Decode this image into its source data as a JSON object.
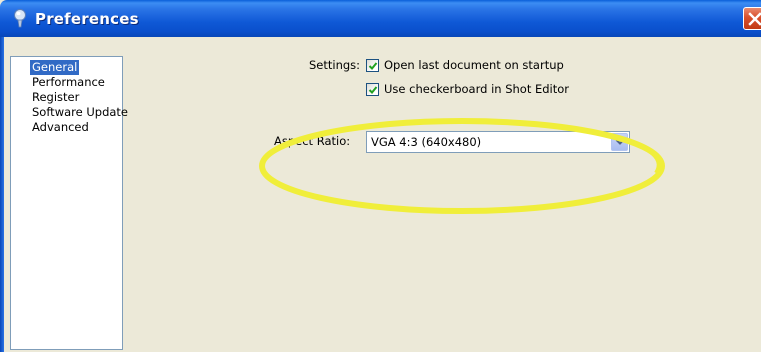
{
  "window": {
    "title": "Preferences",
    "titlebar_color": "#0a4fcc",
    "close_icon": "close-icon"
  },
  "sidebar": {
    "items": [
      {
        "label": "General",
        "selected": true
      },
      {
        "label": "Performance",
        "selected": false
      },
      {
        "label": "Register",
        "selected": false
      },
      {
        "label": "Software Update",
        "selected": false
      },
      {
        "label": "Advanced",
        "selected": false
      }
    ],
    "selection_color": "#316ac5"
  },
  "settings": {
    "label": "Settings:",
    "open_last_document": {
      "label": "Open last document on startup",
      "checked": true
    },
    "use_checkerboard": {
      "label": "Use checkerboard in Shot Editor",
      "checked": true
    }
  },
  "aspect_ratio": {
    "label": "Aspect Ratio:",
    "selected_value": "VGA 4:3 (640x480)"
  },
  "annotation": {
    "highlight_color": "#f0ee3a",
    "shape": "ellipse"
  }
}
